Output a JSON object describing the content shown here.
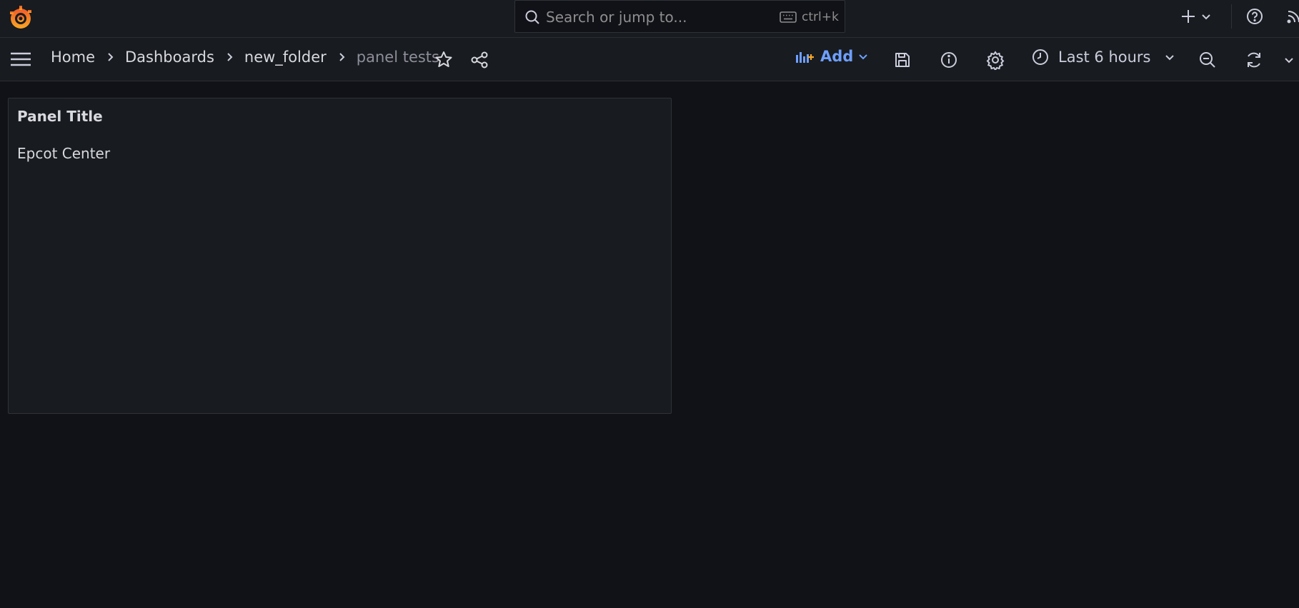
{
  "topbar": {
    "logo_icon": "grafana-logo-icon",
    "search": {
      "placeholder": "Search or jump to...",
      "shortcut": "ctrl+k"
    },
    "plus_menu_icon": "plus-icon",
    "help_icon": "help-icon",
    "rss_icon": "rss-icon"
  },
  "navbar": {
    "menu_icon": "hamburger-menu-icon",
    "breadcrumb": [
      {
        "label": "Home"
      },
      {
        "label": "Dashboards"
      },
      {
        "label": "new_folder"
      },
      {
        "label": "panel tests"
      }
    ],
    "add_label": "Add",
    "time_range": "Last 6 hours"
  },
  "panel": {
    "title": "Panel Title",
    "text": "Epcot Center"
  },
  "colors": {
    "background": "#111217",
    "bar": "#181b1f",
    "accent": "#6e9fff",
    "logo": "#f05a28"
  }
}
